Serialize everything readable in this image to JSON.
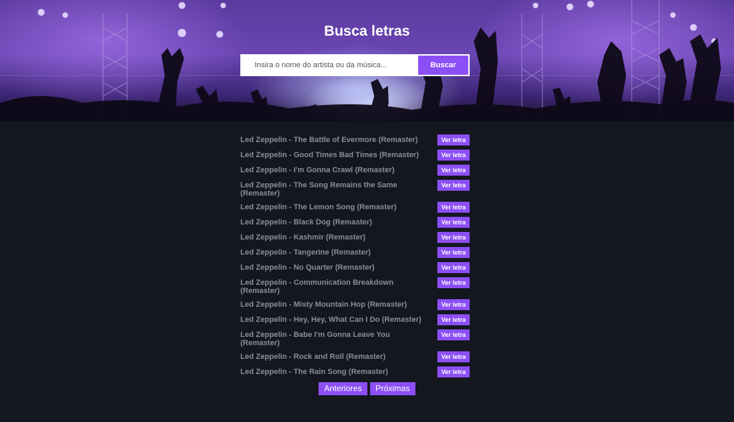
{
  "header": {
    "title": "Busca letras"
  },
  "search": {
    "placeholder": "Insira o nome do artista ou da música...",
    "button_label": "Buscar"
  },
  "results": {
    "button_label": "Ver letra",
    "items": [
      "Led Zeppelin - The Battle of Evermore (Remaster)",
      "Led Zeppelin - Good Times Bad Times (Remaster)",
      "Led Zeppelin - I'm Gonna Crawl (Remaster)",
      "Led Zeppelin - The Song Remains the Same (Remaster)",
      "Led Zeppelin - The Lemon Song (Remaster)",
      "Led Zeppelin - Black Dog (Remaster)",
      "Led Zeppelin - Kashmir (Remaster)",
      "Led Zeppelin - Tangerine (Remaster)",
      "Led Zeppelin - No Quarter (Remaster)",
      "Led Zeppelin - Communication Breakdown (Remaster)",
      "Led Zeppelin - Misty Mountain Hop (Remaster)",
      "Led Zeppelin - Hey, Hey, What Can I Do (Remaster)",
      "Led Zeppelin - Babe I'm Gonna Leave You (Remaster)",
      "Led Zeppelin - Rock and Roll (Remaster)",
      "Led Zeppelin - The Rain Song (Remaster)"
    ]
  },
  "pagination": {
    "previous_label": "Anteriores",
    "next_label": "Próximas"
  },
  "colors": {
    "accent": "#8c4ff5",
    "background": "#141720",
    "song_text": "#8a8d92"
  }
}
